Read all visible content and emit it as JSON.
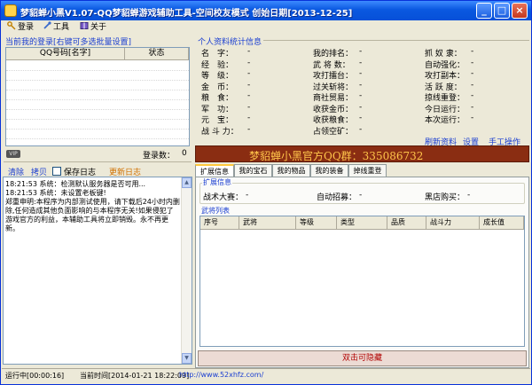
{
  "window": {
    "title": "梦貂蝉小黑V1.07-QQ梦貂蝉游戏辅助工具-空间校友模式  创始日期[2013-12-25]",
    "min": "_",
    "max": "□",
    "close": "×"
  },
  "menu": {
    "login": "登录",
    "tools": "工具",
    "about": "关于"
  },
  "left": {
    "title": "当前我的登录[右键可多选批量设置]",
    "list_headers": {
      "account": "QQ号码[名字]",
      "status": "状态"
    },
    "vip": "VIP",
    "login_count_label": "登录数：",
    "login_count": "0",
    "actions": {
      "clear": "清除",
      "copy": "拷贝",
      "save_log": "保存日志",
      "update_log": "更新日志"
    },
    "log": [
      "18:21:53 系统：检测默认服务器是否可用...",
      "18:21:53 系统：未设置老板键!",
      "郑重申明:本程序为内部测试使用，请下载后24小时内删",
      "除,任何造成其他负面影响的与本程序无关!如果侵犯了",
      "游戏官方的利益，本辅助工具将立即销毁。永不再更",
      "新。"
    ]
  },
  "stats": {
    "title": "个人资料统计信息",
    "rows": [
      [
        {
          "label": "名　字：",
          "value": "-"
        },
        {
          "label": "我的排名：",
          "value": "-"
        },
        {
          "label": "抓 奴 隶：",
          "value": "-"
        }
      ],
      [
        {
          "label": "经　验：",
          "value": "-"
        },
        {
          "label": "武 将 数：",
          "value": "-"
        },
        {
          "label": "自动强化：",
          "value": "-"
        }
      ],
      [
        {
          "label": "等　级：",
          "value": "-"
        },
        {
          "label": "攻打擂台：",
          "value": "-"
        },
        {
          "label": "攻打副本：",
          "value": "-"
        }
      ],
      [
        {
          "label": "金　币：",
          "value": "-"
        },
        {
          "label": "过关斩将：",
          "value": "-"
        },
        {
          "label": "活 跃 度：",
          "value": "-"
        }
      ],
      [
        {
          "label": "粮　食：",
          "value": "-"
        },
        {
          "label": "商社贸易：",
          "value": "-"
        },
        {
          "label": "掠线重登：",
          "value": "-"
        }
      ],
      [
        {
          "label": "军　功：",
          "value": "-"
        },
        {
          "label": "收获金币：",
          "value": "-"
        },
        {
          "label": "今日运行：",
          "value": "-"
        }
      ],
      [
        {
          "label": "元　宝：",
          "value": "-"
        },
        {
          "label": "收获粮食：",
          "value": "-"
        },
        {
          "label": "本次运行：",
          "value": "-"
        }
      ],
      [
        {
          "label": "战 斗 力：",
          "value": "-"
        },
        {
          "label": "占领空矿：",
          "value": "-"
        }
      ]
    ],
    "links": {
      "refresh": "刷新资料",
      "settings": "设置",
      "manual": "手工操作"
    }
  },
  "banner": "梦貂蝉小黑官方QQ群：335086732",
  "tabs": [
    "扩展信息",
    "我的宝石",
    "我的物品",
    "我的装备",
    "掉线重登"
  ],
  "ext": {
    "group_title": "扩展信息",
    "fields": [
      {
        "label": "战术大赛：",
        "value": "-"
      },
      {
        "label": "自动招募：",
        "value": "-"
      },
      {
        "label": "黑店购买：",
        "value": "-"
      }
    ]
  },
  "generals": {
    "group_title": "武将列表",
    "headers": [
      "序号",
      "武将",
      "等级",
      "类型",
      "品质",
      "战斗力",
      "成长值"
    ]
  },
  "hide_button": "双击可隐藏",
  "status": {
    "running": "运行中[00:00:16]",
    "time": "当前时间[2014-01-21 18:22:09]",
    "url": "http://www.52xhfz.com/"
  }
}
